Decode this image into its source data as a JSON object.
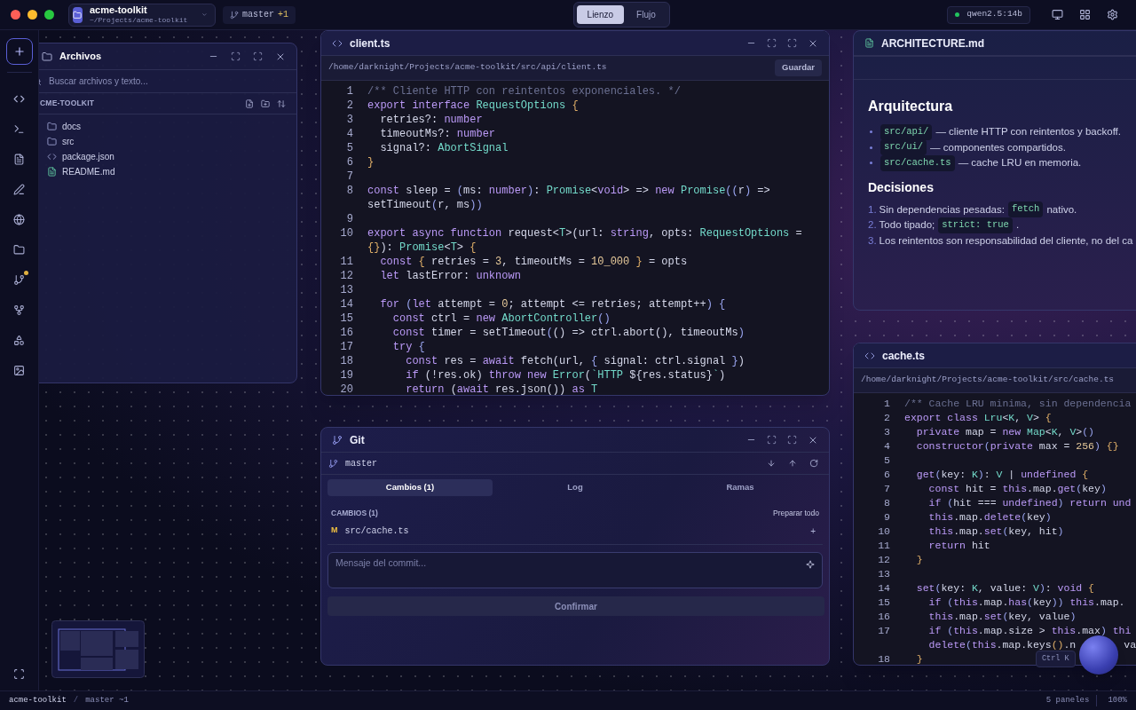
{
  "top_bar": {
    "project": {
      "name": "acme-toolkit",
      "path": "~/Projects/acme-toolkit"
    },
    "branch": {
      "name": "master",
      "ahead": "+1"
    },
    "view_switch": [
      {
        "label": "Lienzo",
        "selected": true
      },
      {
        "label": "Flujo",
        "selected": false
      }
    ],
    "model": {
      "label": "qwen2.5:14b",
      "online": true
    }
  },
  "activity_bar": {
    "changes_badge": true
  },
  "files_panel": {
    "title": "Archivos",
    "search_placeholder": "Buscar archivos y texto...",
    "root": "CME-TOOLKIT",
    "items": [
      {
        "kind": "folder",
        "name": "docs"
      },
      {
        "kind": "folder",
        "name": "src"
      },
      {
        "kind": "code",
        "name": "package.json"
      },
      {
        "kind": "markdown",
        "name": "README.md"
      }
    ]
  },
  "editors": [
    {
      "title": "client.ts",
      "path": "/home/darknight/Projects/acme-toolkit/src/api/client.ts",
      "save_label": "Guardar",
      "lines": [
        {
          "n": "1",
          "tokens": [
            {
              "kind": "comment",
              "text": "/** Cliente HTTP con reintentos exponenciales. */"
            }
          ]
        },
        {
          "n": "2",
          "tokens": [
            {
              "kind": "kw",
              "text": "export interface "
            },
            {
              "kind": "type",
              "text": "RequestOptions"
            },
            {
              "kind": "brace",
              "text": " {"
            }
          ]
        },
        {
          "n": "3",
          "tokens": [
            {
              "kind": "plain",
              "text": "  retries?: "
            },
            {
              "kind": "kw",
              "text": "number"
            }
          ]
        },
        {
          "n": "4",
          "tokens": [
            {
              "kind": "plain",
              "text": "  timeoutMs?: "
            },
            {
              "kind": "kw",
              "text": "number"
            }
          ]
        },
        {
          "n": "5",
          "tokens": [
            {
              "kind": "plain",
              "text": "  signal?: "
            },
            {
              "kind": "type",
              "text": "AbortSignal"
            }
          ]
        },
        {
          "n": "6",
          "tokens": [
            {
              "kind": "brace",
              "text": "}"
            }
          ]
        },
        {
          "n": "7"
        },
        {
          "n": "8",
          "tokens": [
            {
              "kind": "kw",
              "text": "const "
            },
            {
              "kind": "plain",
              "text": "sleep = "
            },
            {
              "kind": "paren",
              "text": "("
            },
            {
              "kind": "plain",
              "text": "ms: "
            },
            {
              "kind": "kw",
              "text": "number"
            },
            {
              "kind": "paren",
              "text": ")"
            },
            {
              "kind": "plain",
              "text": ": "
            },
            {
              "kind": "type",
              "text": "Promise"
            },
            {
              "kind": "plain",
              "text": "<"
            },
            {
              "kind": "kw",
              "text": "void"
            },
            {
              "kind": "plain",
              "text": "> => "
            },
            {
              "kind": "kw",
              "text": "new "
            },
            {
              "kind": "type",
              "text": "Promise"
            },
            {
              "kind": "paren",
              "text": "(("
            },
            {
              "kind": "plain",
              "text": "r"
            },
            {
              "kind": "paren",
              "text": ")"
            },
            {
              "kind": "plain",
              "text": " =>"
            }
          ]
        },
        {
          "tokens": [
            {
              "kind": "plain",
              "text": "setTimeout"
            },
            {
              "kind": "paren",
              "text": "("
            },
            {
              "kind": "plain",
              "text": "r, ms"
            },
            {
              "kind": "paren",
              "text": "))"
            }
          ]
        },
        {
          "n": "9"
        },
        {
          "n": "10",
          "tokens": [
            {
              "kind": "kw",
              "text": "export async function "
            },
            {
              "kind": "plain",
              "text": "request<"
            },
            {
              "kind": "type",
              "text": "T"
            },
            {
              "kind": "plain",
              "text": ">(url: "
            },
            {
              "kind": "kw",
              "text": "string"
            },
            {
              "kind": "plain",
              "text": ", opts: "
            },
            {
              "kind": "type",
              "text": "RequestOptions"
            },
            {
              "kind": "plain",
              "text": " ="
            }
          ]
        },
        {
          "tokens": [
            {
              "kind": "brace",
              "text": "{}"
            },
            {
              "kind": "plain",
              "text": "): "
            },
            {
              "kind": "type",
              "text": "Promise"
            },
            {
              "kind": "plain",
              "text": "<"
            },
            {
              "kind": "type",
              "text": "T"
            },
            {
              "kind": "plain",
              "text": ">"
            },
            {
              "kind": "brace",
              "text": " {"
            }
          ]
        },
        {
          "n": "11",
          "tokens": [
            {
              "kind": "kw",
              "text": "  const "
            },
            {
              "kind": "brace",
              "text": "{ "
            },
            {
              "kind": "plain",
              "text": "retries = "
            },
            {
              "kind": "num",
              "text": "3"
            },
            {
              "kind": "plain",
              "text": ", timeoutMs = "
            },
            {
              "kind": "num",
              "text": "10_000"
            },
            {
              "kind": "brace",
              "text": " }"
            },
            {
              "kind": "plain",
              "text": " = opts"
            }
          ]
        },
        {
          "n": "12",
          "tokens": [
            {
              "kind": "kw",
              "text": "  let "
            },
            {
              "kind": "plain",
              "text": "lastError: "
            },
            {
              "kind": "kw",
              "text": "unknown"
            }
          ]
        },
        {
          "n": "13"
        },
        {
          "n": "14",
          "tokens": [
            {
              "kind": "kw",
              "text": "  for "
            },
            {
              "kind": "paren",
              "text": "("
            },
            {
              "kind": "kw",
              "text": "let "
            },
            {
              "kind": "plain",
              "text": "attempt = "
            },
            {
              "kind": "num",
              "text": "0"
            },
            {
              "kind": "plain",
              "text": "; attempt <= retries; attempt++"
            },
            {
              "kind": "paren",
              "text": ") {"
            }
          ]
        },
        {
          "n": "15",
          "tokens": [
            {
              "kind": "kw",
              "text": "    const "
            },
            {
              "kind": "plain",
              "text": "ctrl = "
            },
            {
              "kind": "kw",
              "text": "new "
            },
            {
              "kind": "type",
              "text": "AbortController"
            },
            {
              "kind": "paren",
              "text": "()"
            }
          ]
        },
        {
          "n": "16",
          "tokens": [
            {
              "kind": "kw",
              "text": "    const "
            },
            {
              "kind": "plain",
              "text": "timer = setTimeout"
            },
            {
              "kind": "paren",
              "text": "("
            },
            {
              "kind": "plain",
              "text": "() => ctrl.abort(), timeoutMs"
            },
            {
              "kind": "paren",
              "text": ")"
            }
          ]
        },
        {
          "n": "17",
          "tokens": [
            {
              "kind": "kw",
              "text": "    try "
            },
            {
              "kind": "paren",
              "text": "{"
            }
          ]
        },
        {
          "n": "18",
          "tokens": [
            {
              "kind": "kw",
              "text": "      const "
            },
            {
              "kind": "plain",
              "text": "res = "
            },
            {
              "kind": "kw",
              "text": "await "
            },
            {
              "kind": "plain",
              "text": "fetch(url, "
            },
            {
              "kind": "paren",
              "text": "{ "
            },
            {
              "kind": "plain",
              "text": "signal: ctrl.signal "
            },
            {
              "kind": "paren",
              "text": "}"
            },
            {
              "kind": "plain",
              "text": ")"
            }
          ]
        },
        {
          "n": "19",
          "tokens": [
            {
              "kind": "kw",
              "text": "      if "
            },
            {
              "kind": "plain",
              "text": "(!res.ok) "
            },
            {
              "kind": "kw",
              "text": "throw new "
            },
            {
              "kind": "type",
              "text": "Error"
            },
            {
              "kind": "plain",
              "text": "("
            },
            {
              "kind": "type",
              "text": "`HTTP "
            },
            {
              "kind": "plain",
              "text": "${res.status}"
            },
            {
              "kind": "type",
              "text": "`"
            },
            {
              "kind": "plain",
              "text": ")"
            }
          ]
        },
        {
          "n": "20",
          "tokens": [
            {
              "kind": "kw",
              "text": "      return "
            },
            {
              "kind": "plain",
              "text": "("
            },
            {
              "kind": "kw",
              "text": "await "
            },
            {
              "kind": "plain",
              "text": "res.json()) "
            },
            {
              "kind": "kw",
              "text": "as "
            },
            {
              "kind": "type",
              "text": "T"
            }
          ]
        }
      ]
    },
    {
      "title": "cache.ts",
      "path": "/home/darknight/Projects/acme-toolkit/src/cache.ts",
      "lines": [
        {
          "n": "1",
          "tokens": [
            {
              "kind": "comment",
              "text": "/** Cache LRU minima, sin dependencia"
            }
          ]
        },
        {
          "n": "2",
          "tokens": [
            {
              "kind": "kw",
              "text": "export class "
            },
            {
              "kind": "type",
              "text": "Lru"
            },
            {
              "kind": "plain",
              "text": "<"
            },
            {
              "kind": "type",
              "text": "K"
            },
            {
              "kind": "plain",
              "text": ", "
            },
            {
              "kind": "type",
              "text": "V"
            },
            {
              "kind": "plain",
              "text": ">"
            },
            {
              "kind": "brace",
              "text": " {"
            }
          ]
        },
        {
          "n": "3",
          "tokens": [
            {
              "kind": "kw",
              "text": "  private "
            },
            {
              "kind": "plain",
              "text": "map = "
            },
            {
              "kind": "kw",
              "text": "new "
            },
            {
              "kind": "type",
              "text": "Map"
            },
            {
              "kind": "plain",
              "text": "<"
            },
            {
              "kind": "type",
              "text": "K"
            },
            {
              "kind": "plain",
              "text": ", "
            },
            {
              "kind": "type",
              "text": "V"
            },
            {
              "kind": "plain",
              "text": ">"
            },
            {
              "kind": "paren",
              "text": "()"
            }
          ]
        },
        {
          "n": "4",
          "tokens": [
            {
              "kind": "kw",
              "text": "  constructor"
            },
            {
              "kind": "paren",
              "text": "("
            },
            {
              "kind": "kw",
              "text": "private "
            },
            {
              "kind": "plain",
              "text": "max = "
            },
            {
              "kind": "num",
              "text": "256"
            },
            {
              "kind": "paren",
              "text": ")"
            },
            {
              "kind": "brace",
              "text": " {}"
            }
          ]
        },
        {
          "n": "5"
        },
        {
          "n": "6",
          "tokens": [
            {
              "kind": "kw",
              "text": "  get"
            },
            {
              "kind": "paren",
              "text": "("
            },
            {
              "kind": "plain",
              "text": "key: "
            },
            {
              "kind": "type",
              "text": "K"
            },
            {
              "kind": "paren",
              "text": ")"
            },
            {
              "kind": "plain",
              "text": ": "
            },
            {
              "kind": "type",
              "text": "V"
            },
            {
              "kind": "plain",
              "text": " | "
            },
            {
              "kind": "kw",
              "text": "undefined"
            },
            {
              "kind": "brace",
              "text": " {"
            }
          ]
        },
        {
          "n": "7",
          "tokens": [
            {
              "kind": "kw",
              "text": "    const "
            },
            {
              "kind": "plain",
              "text": "hit = "
            },
            {
              "kind": "kw",
              "text": "this"
            },
            {
              "kind": "plain",
              "text": ".map."
            },
            {
              "kind": "kw",
              "text": "get"
            },
            {
              "kind": "paren",
              "text": "("
            },
            {
              "kind": "plain",
              "text": "key"
            },
            {
              "kind": "paren",
              "text": ")"
            }
          ]
        },
        {
          "n": "8",
          "tokens": [
            {
              "kind": "kw",
              "text": "    if "
            },
            {
              "kind": "paren",
              "text": "("
            },
            {
              "kind": "plain",
              "text": "hit === "
            },
            {
              "kind": "kw",
              "text": "undefined"
            },
            {
              "kind": "paren",
              "text": ")"
            },
            {
              "kind": "kw",
              "text": " return und"
            }
          ]
        },
        {
          "n": "9",
          "tokens": [
            {
              "kind": "kw",
              "text": "    this"
            },
            {
              "kind": "plain",
              "text": ".map."
            },
            {
              "kind": "kw",
              "text": "delete"
            },
            {
              "kind": "paren",
              "text": "("
            },
            {
              "kind": "plain",
              "text": "key"
            },
            {
              "kind": "paren",
              "text": ")"
            }
          ]
        },
        {
          "n": "10",
          "tokens": [
            {
              "kind": "kw",
              "text": "    this"
            },
            {
              "kind": "plain",
              "text": ".map."
            },
            {
              "kind": "kw",
              "text": "set"
            },
            {
              "kind": "paren",
              "text": "("
            },
            {
              "kind": "plain",
              "text": "key, hit"
            },
            {
              "kind": "paren",
              "text": ")"
            }
          ]
        },
        {
          "n": "11",
          "tokens": [
            {
              "kind": "kw",
              "text": "    return "
            },
            {
              "kind": "plain",
              "text": "hit"
            }
          ]
        },
        {
          "n": "12",
          "tokens": [
            {
              "kind": "brace",
              "text": "  }"
            }
          ]
        },
        {
          "n": "13"
        },
        {
          "n": "14",
          "tokens": [
            {
              "kind": "kw",
              "text": "  set"
            },
            {
              "kind": "paren",
              "text": "("
            },
            {
              "kind": "plain",
              "text": "key: "
            },
            {
              "kind": "type",
              "text": "K"
            },
            {
              "kind": "plain",
              "text": ", value: "
            },
            {
              "kind": "type",
              "text": "V"
            },
            {
              "kind": "paren",
              "text": ")"
            },
            {
              "kind": "plain",
              "text": ": "
            },
            {
              "kind": "kw",
              "text": "void "
            },
            {
              "kind": "brace",
              "text": "{"
            }
          ]
        },
        {
          "n": "15",
          "tokens": [
            {
              "kind": "kw",
              "text": "    if "
            },
            {
              "kind": "paren",
              "text": "("
            },
            {
              "kind": "kw",
              "text": "this"
            },
            {
              "kind": "plain",
              "text": ".map."
            },
            {
              "kind": "kw",
              "text": "has"
            },
            {
              "kind": "paren",
              "text": "("
            },
            {
              "kind": "plain",
              "text": "key"
            },
            {
              "kind": "paren",
              "text": "))"
            },
            {
              "kind": "kw",
              "text": " this"
            },
            {
              "kind": "plain",
              "text": ".map."
            }
          ]
        },
        {
          "n": "16",
          "tokens": [
            {
              "kind": "kw",
              "text": "    this"
            },
            {
              "kind": "plain",
              "text": ".map."
            },
            {
              "kind": "kw",
              "text": "set"
            },
            {
              "kind": "paren",
              "text": "("
            },
            {
              "kind": "plain",
              "text": "key, value"
            },
            {
              "kind": "paren",
              "text": ")"
            }
          ]
        },
        {
          "n": "17",
          "tokens": [
            {
              "kind": "kw",
              "text": "    if "
            },
            {
              "kind": "paren",
              "text": "("
            },
            {
              "kind": "kw",
              "text": "this"
            },
            {
              "kind": "plain",
              "text": ".map.size > "
            },
            {
              "kind": "kw",
              "text": "this"
            },
            {
              "kind": "plain",
              "text": ".max"
            },
            {
              "kind": "paren",
              "text": ")"
            },
            {
              "kind": "kw",
              "text": " thi"
            }
          ]
        },
        {
          "tokens": [
            {
              "kind": "kw",
              "text": "    delete"
            },
            {
              "kind": "paren",
              "text": "("
            },
            {
              "kind": "kw",
              "text": "this"
            },
            {
              "kind": "plain",
              "text": ".map.keys"
            },
            {
              "kind": "brace",
              "text": "()"
            },
            {
              "kind": "plain",
              "text": ".n"
            },
            {
              "kind": "gap"
            },
            {
              "kind": "plain",
              "text": "va"
            }
          ]
        },
        {
          "n": "18",
          "tokens": [
            {
              "kind": "brace",
              "text": "  }"
            }
          ]
        }
      ]
    }
  ],
  "markdown_panel": {
    "title": "ARCHITECTURE.md",
    "heading": "Arquitectura",
    "bullets": [
      [
        {
          "kind": "code",
          "text": "src/api/"
        },
        {
          "kind": "text",
          "text": "— cliente HTTP con reintentos y backoff."
        }
      ],
      [
        {
          "kind": "code",
          "text": "src/ui/"
        },
        {
          "kind": "text",
          "text": "— componentes compartidos."
        }
      ],
      [
        {
          "kind": "code",
          "text": "src/cache.ts"
        },
        {
          "kind": "text",
          "text": "— cache LRU en memoria."
        }
      ]
    ],
    "subheading": "Decisiones",
    "numbered": [
      {
        "marker": "1.",
        "parts": [
          {
            "kind": "text",
            "text": "Sin dependencias pesadas:"
          },
          {
            "kind": "code",
            "text": "fetch"
          },
          {
            "kind": "text",
            "text": "nativo."
          }
        ]
      },
      {
        "marker": "2.",
        "parts": [
          {
            "kind": "text",
            "text": "Todo tipado;"
          },
          {
            "kind": "code",
            "text": "strict: true"
          },
          {
            "kind": "text",
            "text": "."
          }
        ]
      },
      {
        "marker": "3.",
        "parts": [
          {
            "kind": "text",
            "text": "Los reintentos son responsabilidad del cliente, no del ca"
          }
        ]
      }
    ]
  },
  "git_panel": {
    "title": "Git",
    "branch": "master",
    "tabs": [
      {
        "label": "Cambios (1)",
        "selected": true
      },
      {
        "label": "Log",
        "selected": false
      },
      {
        "label": "Ramas",
        "selected": false
      }
    ],
    "section": "CAMBIOS (1)",
    "stage_all": "Preparar todo",
    "changes": [
      {
        "status": "M",
        "path": "src/cache.ts",
        "action": "+"
      }
    ],
    "commit_placeholder": "Mensaje del commit...",
    "commit_button": {
      "label": "Confirmar",
      "disabled": true
    }
  },
  "shortcut_hint": "Ctrl K",
  "status_bar": {
    "project": "acme-toolkit",
    "separator": "/",
    "branch": "master ~1",
    "panels": "5 paneles",
    "zoom": "100%"
  }
}
